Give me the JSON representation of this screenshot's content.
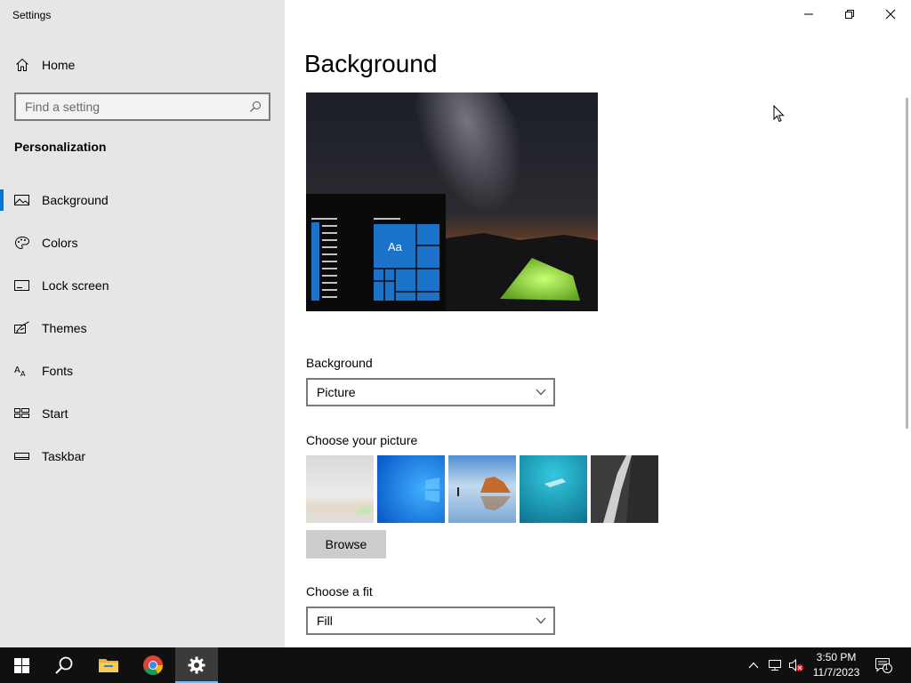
{
  "window": {
    "title": "Settings",
    "controls": [
      "minimize",
      "restore",
      "close"
    ]
  },
  "sidebar": {
    "home_label": "Home",
    "search": {
      "placeholder": "Find a setting"
    },
    "section_title": "Personalization",
    "items": [
      {
        "label": "Background",
        "icon": "picture-icon",
        "active": true
      },
      {
        "label": "Colors",
        "icon": "palette-icon",
        "active": false
      },
      {
        "label": "Lock screen",
        "icon": "lock-screen-icon",
        "active": false
      },
      {
        "label": "Themes",
        "icon": "themes-icon",
        "active": false
      },
      {
        "label": "Fonts",
        "icon": "fonts-icon",
        "active": false
      },
      {
        "label": "Start",
        "icon": "start-icon",
        "active": false
      },
      {
        "label": "Taskbar",
        "icon": "taskbar-icon",
        "active": false
      }
    ]
  },
  "main": {
    "page_title": "Background",
    "preview": {
      "tile_label": "Aa"
    },
    "background_label": "Background",
    "background_value": "Picture",
    "choose_picture_label": "Choose your picture",
    "pictures": [
      "glow-landscape",
      "windows-blue",
      "beach-rocks",
      "underwater-swimmer",
      "rock-waterfall"
    ],
    "browse_label": "Browse",
    "choose_fit_label": "Choose a fit",
    "fit_value": "Fill"
  },
  "taskbar": {
    "apps": [
      "start-icon",
      "search-icon",
      "file-explorer-icon",
      "chrome-icon",
      "settings-icon"
    ],
    "active_app": "settings-icon",
    "clock": {
      "time": "3:50 PM",
      "date": "11/7/2023"
    },
    "notification_count": "1"
  },
  "colors": {
    "accent": "#0078d7",
    "sidebar_bg": "#e6e6e6",
    "taskbar_bg": "#101010",
    "tent_green": "#8dd63a"
  }
}
